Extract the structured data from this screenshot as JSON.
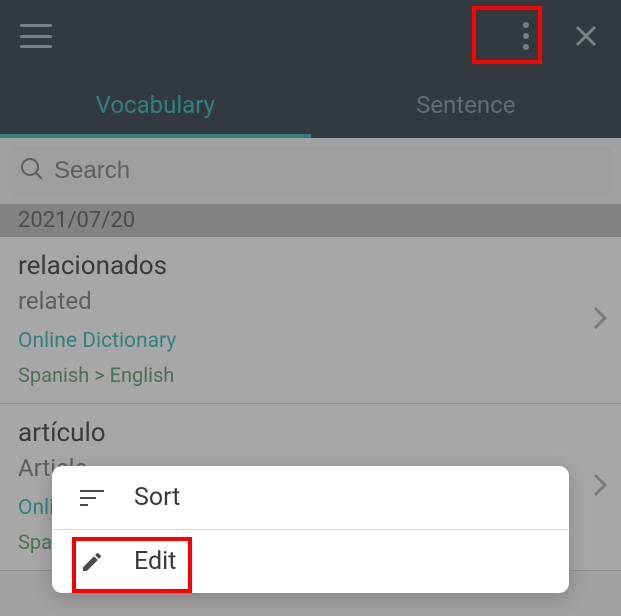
{
  "tabs": {
    "vocabulary": "Vocabulary",
    "sentence": "Sentence"
  },
  "search": {
    "placeholder": "Search"
  },
  "dateHeader": "2021/07/20",
  "entries": [
    {
      "word": "relacionados",
      "translation": "related",
      "source": "Online Dictionary",
      "lang": "Spanish > English"
    },
    {
      "word": "artículo",
      "translation": "Article",
      "source": "Online Dictionary",
      "lang": "Spanish > English"
    }
  ],
  "popup": {
    "sort": "Sort",
    "edit": "Edit"
  }
}
